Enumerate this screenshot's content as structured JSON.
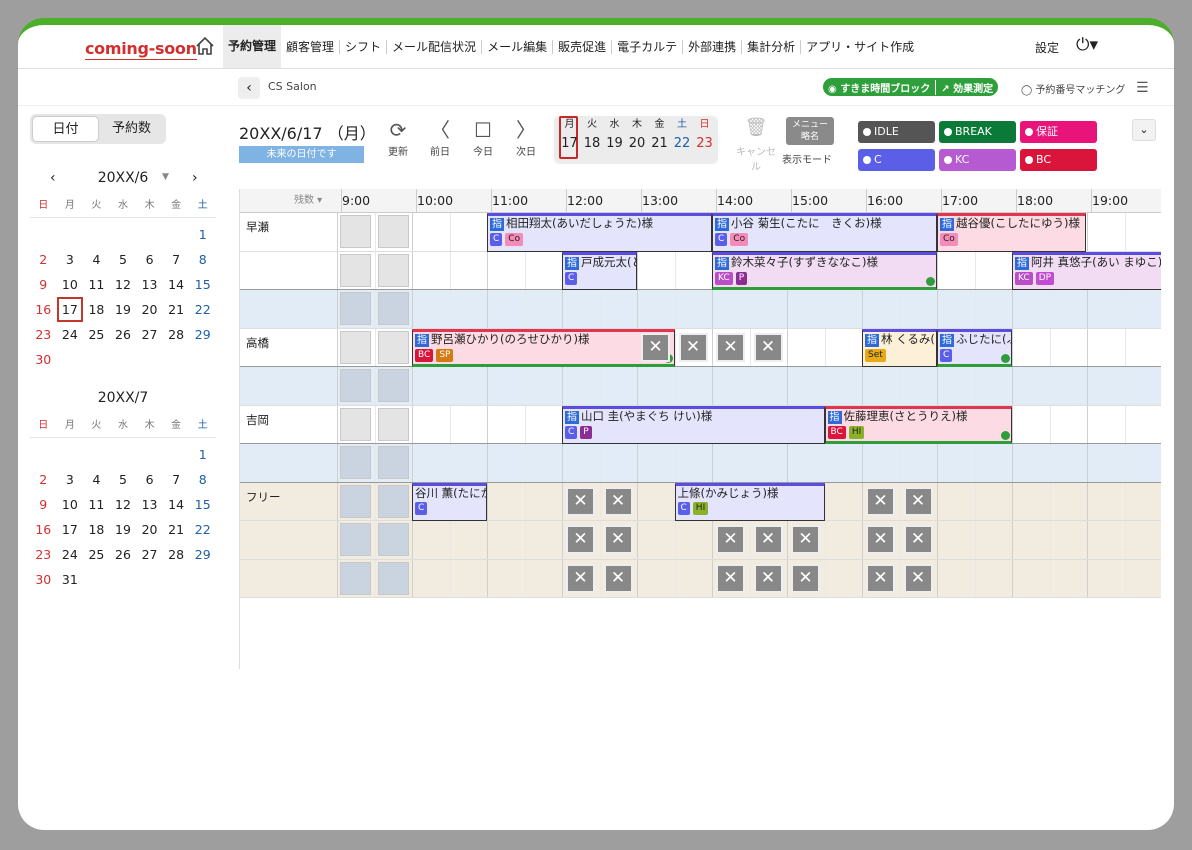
{
  "app": {
    "logo": "coming-soon"
  },
  "nav": {
    "items": [
      "予約管理",
      "顧客管理",
      "シフト",
      "メール配信状況",
      "メール編集",
      "販売促進",
      "電子カルテ",
      "外部連携",
      "集計分析",
      "アプリ・サイト作成"
    ],
    "settings": "設定"
  },
  "sub": {
    "salon": "CS Salon",
    "block_toggle": "すきま時間ブロック",
    "effect": "効果測定",
    "matching": "予約番号マッチング"
  },
  "view_tabs": [
    "日付",
    "予約数"
  ],
  "cal1": {
    "title": "20XX/6",
    "weekdays": [
      "日",
      "月",
      "火",
      "水",
      "木",
      "金",
      "土"
    ],
    "lead": 6,
    "days": 30,
    "selected": 17
  },
  "cal2": {
    "title": "20XX/7",
    "weekdays": [
      "日",
      "月",
      "火",
      "水",
      "木",
      "金",
      "土"
    ],
    "lead": 6,
    "days": 31
  },
  "toolbar": {
    "date": "20XX/6/17 （月）",
    "future": "未来の日付です",
    "refresh": "更新",
    "prev": "前日",
    "today": "今日",
    "next": "次日",
    "cancel": "キャンセル",
    "menu_btn_1": "メニュー",
    "menu_btn_2": "略名",
    "menu_mode": "表示モード"
  },
  "week": {
    "labels": [
      "月",
      "火",
      "水",
      "木",
      "金",
      "土",
      "日"
    ],
    "days": [
      "17",
      "18",
      "19",
      "20",
      "21",
      "22",
      "23"
    ]
  },
  "legend": [
    {
      "label": "IDLE",
      "color": "#555555"
    },
    {
      "label": "BREAK",
      "color": "#0b7a39"
    },
    {
      "label": "保証",
      "color": "#e8147a"
    },
    {
      "label": "C",
      "color": "#5b5fe8"
    },
    {
      "label": "KC",
      "color": "#b55ad0"
    },
    {
      "label": "BC",
      "color": "#d9153b"
    }
  ],
  "schedule": {
    "remaining": "残数",
    "hours": [
      "9:00",
      "10:00",
      "11:00",
      "12:00",
      "13:00",
      "14:00",
      "15:00",
      "16:00",
      "17:00",
      "18:00",
      "19:00"
    ],
    "staff": [
      "早瀬",
      "高橋",
      "吉岡",
      "フリー"
    ],
    "events": [
      {
        "name": "相田翔太(あいだしょうた)様",
        "tags": [
          "C",
          "Co"
        ]
      },
      {
        "name": "小谷 菊生(こたに　きくお)様",
        "tags": [
          "C",
          "Co"
        ]
      },
      {
        "name": "越谷優(こしたにゆう)様",
        "tags": [
          "Co"
        ]
      },
      {
        "name": "戸成元太(と",
        "tags": [
          "C"
        ]
      },
      {
        "name": "鈴木菜々子(すずきななこ)様",
        "tags": [
          "KC",
          "P"
        ]
      },
      {
        "name": "阿井 真悠子(あい まゆこ)",
        "tags": [
          "KC",
          "DP"
        ]
      },
      {
        "name": "野呂瀬ひかり(のろせひかり)様",
        "tags": [
          "BC",
          "SP"
        ]
      },
      {
        "name": "林 くるみ(",
        "tags": [
          "Set"
        ]
      },
      {
        "name": "ふじたに(ふ",
        "tags": [
          "C"
        ]
      },
      {
        "name": "山口 圭(やまぐち けい)様",
        "tags": [
          "C",
          "P"
        ]
      },
      {
        "name": "佐藤理恵(さとうりえ)様",
        "tags": [
          "BC",
          "HI"
        ]
      },
      {
        "name": "谷川 薫(たにか",
        "tags": [
          "C"
        ]
      },
      {
        "name": "上條(かみじょう)様",
        "tags": [
          "C",
          "HI"
        ]
      }
    ]
  }
}
